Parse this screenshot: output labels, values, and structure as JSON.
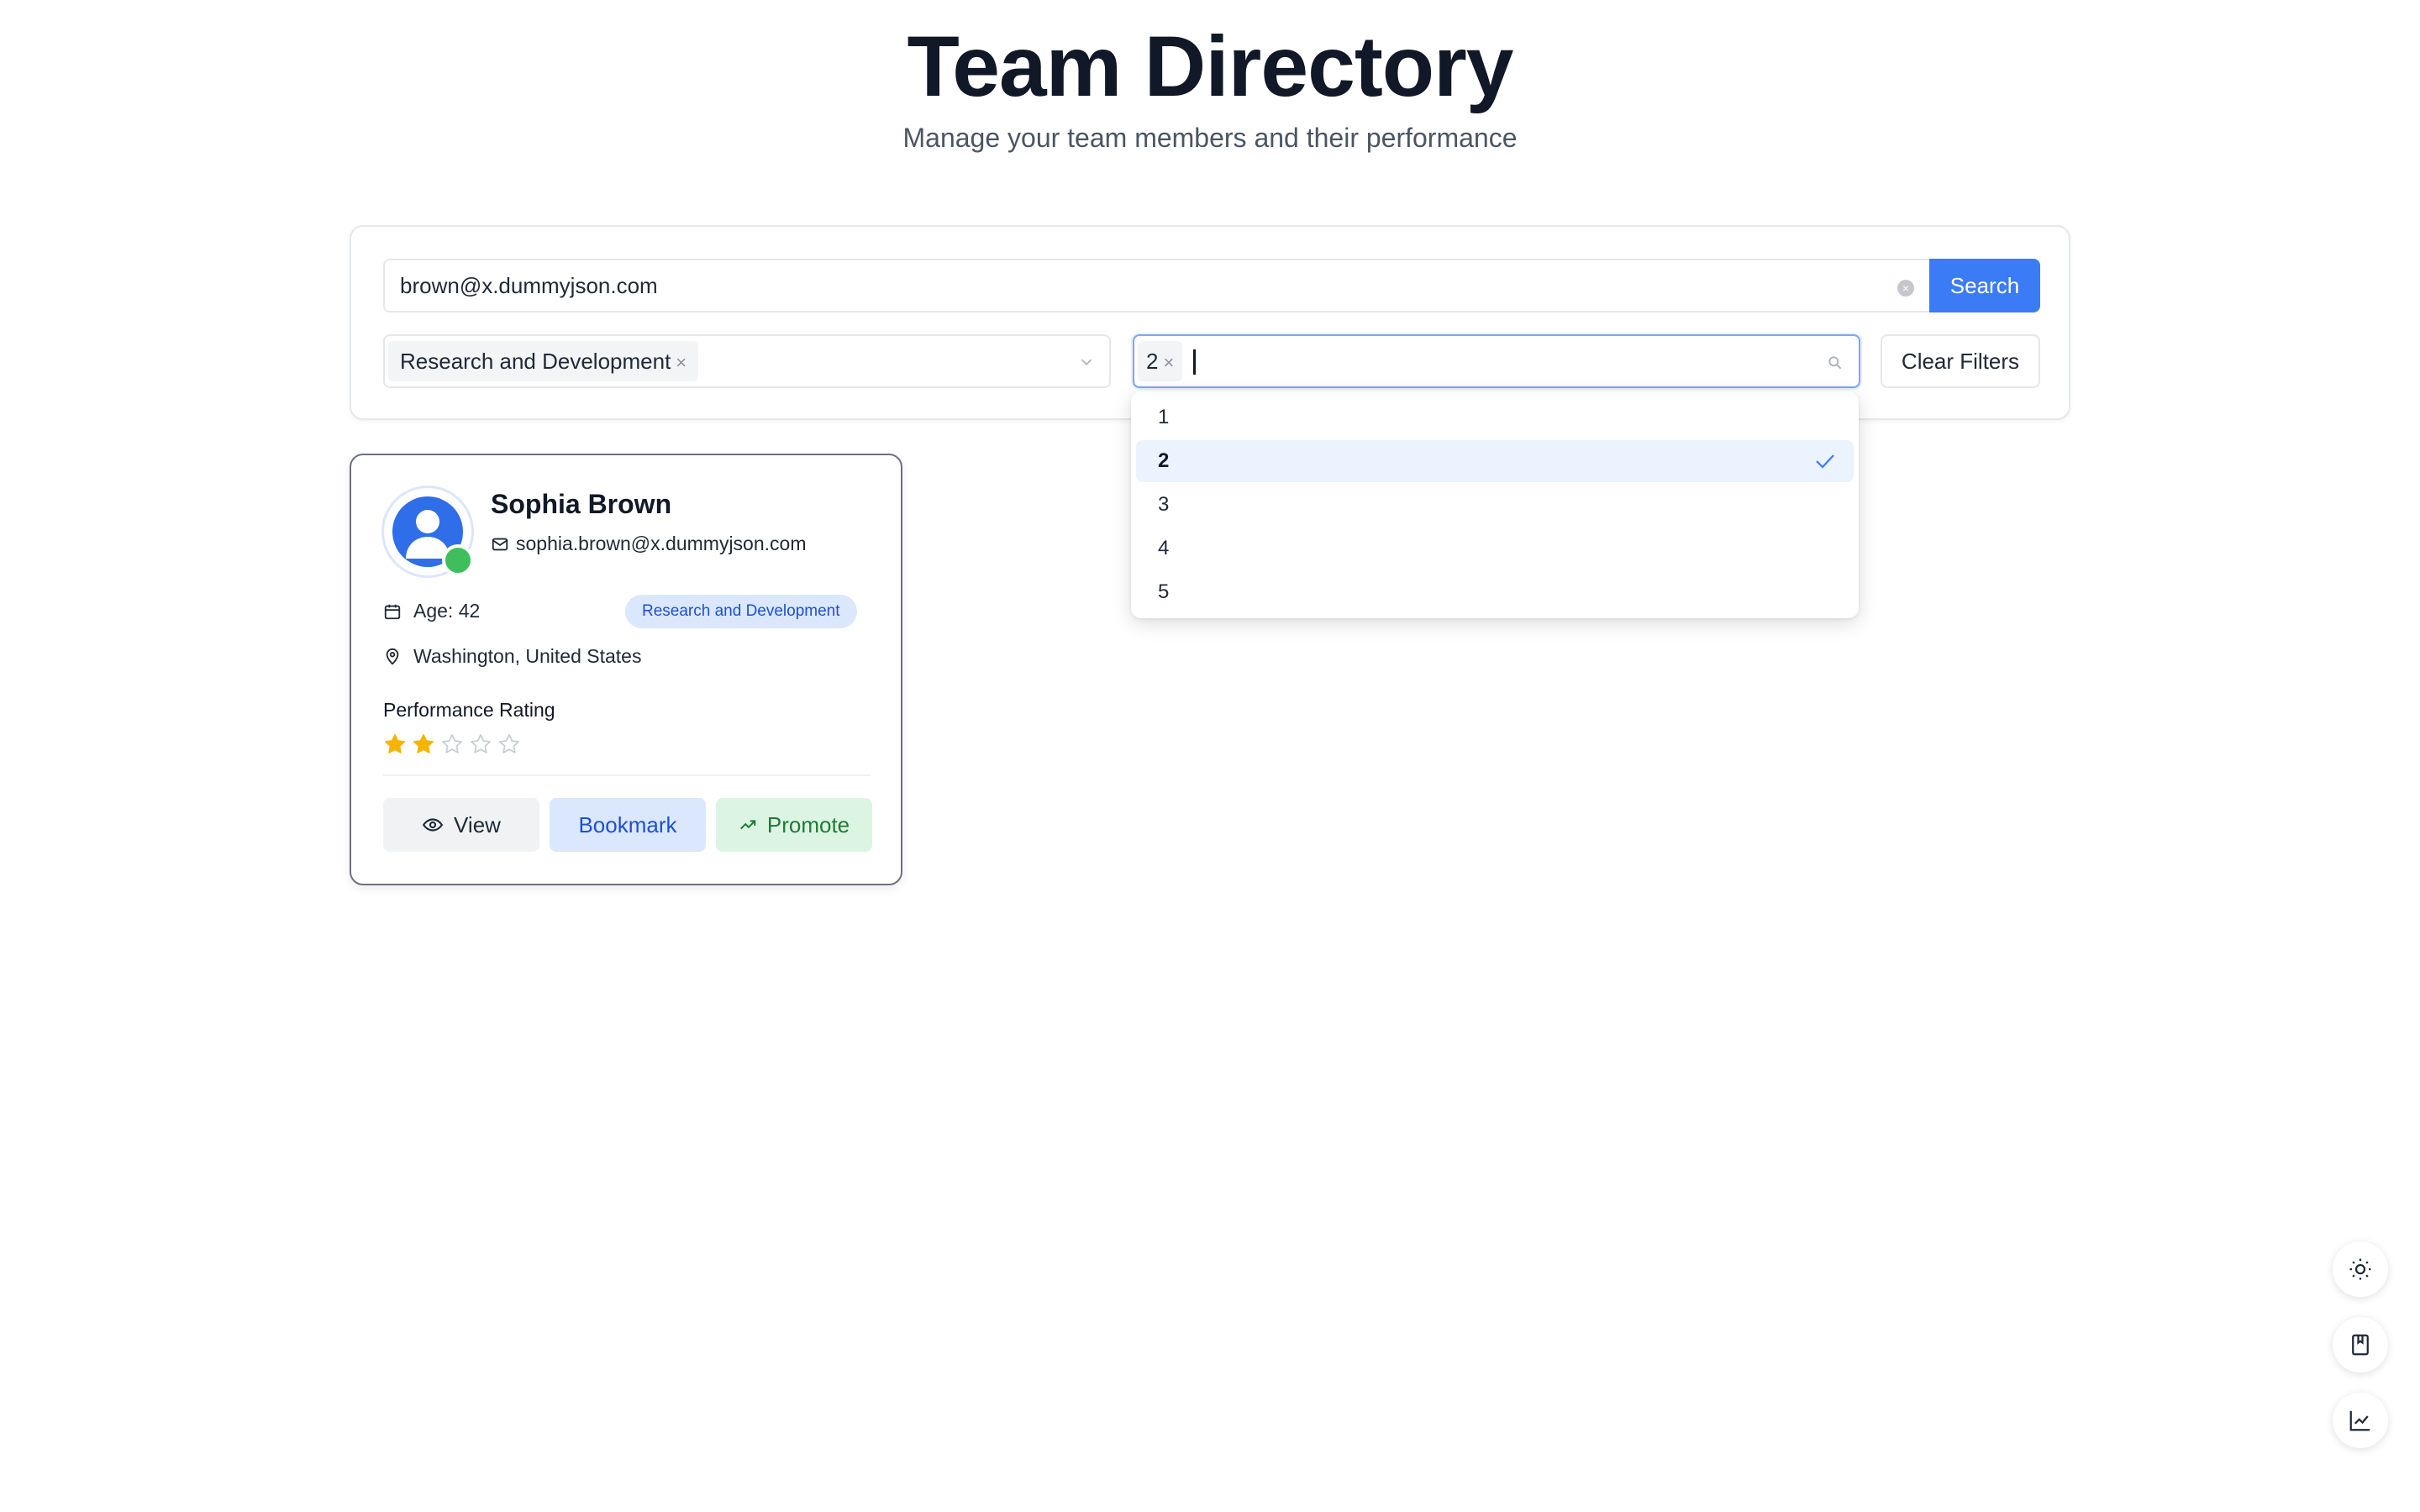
{
  "header": {
    "title": "Team Directory",
    "subtitle": "Manage your team members and their performance"
  },
  "filters": {
    "search_value": "brown@x.dummyjson.com",
    "search_button": "Search",
    "department_tag": "Research and Development",
    "rating_tag": "2",
    "clear_filters": "Clear Filters",
    "rating_options": [
      "1",
      "2",
      "3",
      "4",
      "5"
    ],
    "rating_selected": "2"
  },
  "card": {
    "name": "Sophia Brown",
    "email": "sophia.brown@x.dummyjson.com",
    "age": "Age: 42",
    "department": "Research and Development",
    "location": "Washington, United States",
    "performance_label": "Performance Rating",
    "rating": 2,
    "rating_max": 5,
    "buttons": {
      "view": "View",
      "bookmark": "Bookmark",
      "promote": "Promote"
    }
  },
  "colors": {
    "primary": "#3b7cf6",
    "star_filled": "#f5b400",
    "status_online": "#3fbf5c"
  },
  "icons": [
    "sun-icon",
    "bookmark-icon",
    "chart-icon"
  ]
}
